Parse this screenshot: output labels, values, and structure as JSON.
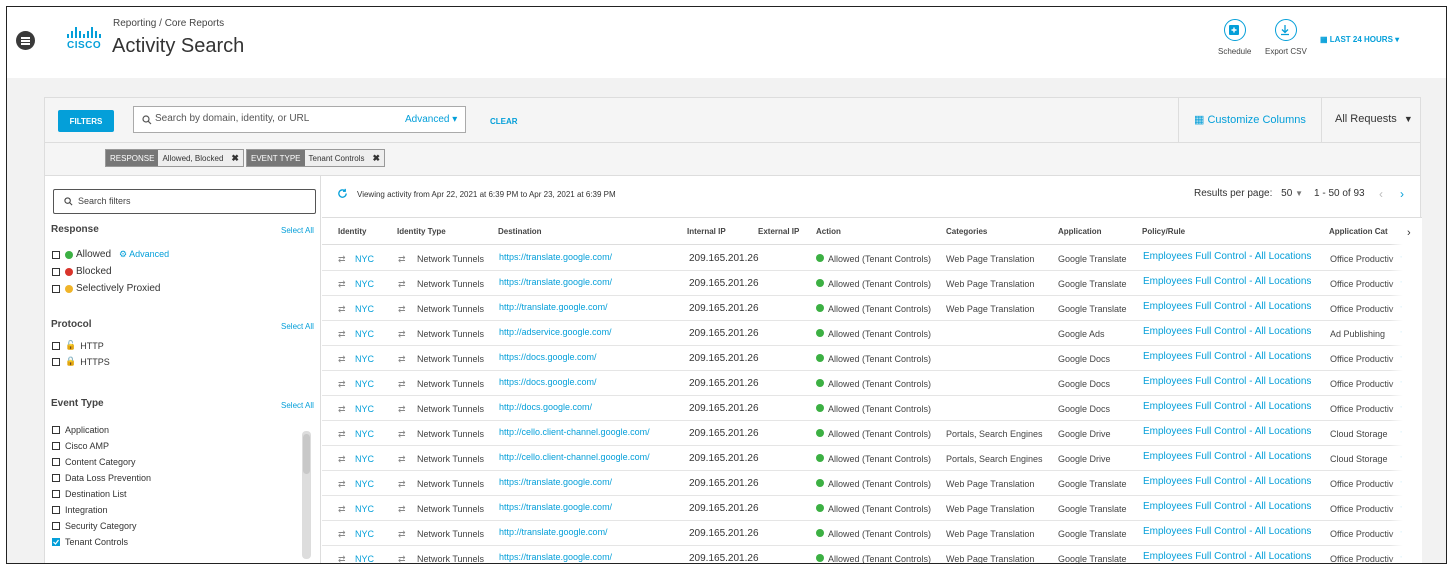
{
  "header": {
    "breadcrumb": "Reporting / Core Reports",
    "title": "Activity Search",
    "logo_text": "CISCO",
    "schedule_label": "Schedule",
    "export_label": "Export CSV",
    "time_range": "LAST 24 HOURS"
  },
  "toolbar": {
    "filters_label": "FILTERS",
    "search_placeholder": "Search by domain, identity, or URL",
    "advanced_label": "Advanced",
    "clear_label": "CLEAR",
    "customize_label": "Customize Columns",
    "requests_label": "All Requests"
  },
  "active_filters": [
    {
      "key": "RESPONSE",
      "value": "Allowed, Blocked"
    },
    {
      "key": "EVENT TYPE",
      "value": "Tenant Controls"
    }
  ],
  "sidebar": {
    "search_placeholder": "Search filters",
    "select_all_label": "Select All",
    "response": {
      "title": "Response",
      "advanced_label": "Advanced",
      "options": [
        "Allowed",
        "Blocked",
        "Selectively Proxied"
      ]
    },
    "protocol": {
      "title": "Protocol",
      "options": [
        "HTTP",
        "HTTPS"
      ]
    },
    "event_type": {
      "title": "Event Type",
      "options": [
        "Application",
        "Cisco AMP",
        "Content Category",
        "Data Loss Prevention",
        "Destination List",
        "Integration",
        "Security Category",
        "Tenant Controls"
      ],
      "checked": "Tenant Controls"
    }
  },
  "results": {
    "viewing_text": "Viewing activity from Apr 22, 2021 at 6:39 PM to Apr 23, 2021 at 6:39 PM",
    "per_page_label": "Results per page:",
    "per_page_value": "50",
    "range_text": "1 - 50 of 93"
  },
  "columns": [
    "Identity",
    "Identity Type",
    "Destination",
    "Internal IP",
    "External IP",
    "Action",
    "Categories",
    "Application",
    "Policy/Rule",
    "Application Cat"
  ],
  "rows": [
    {
      "identity": "NYC",
      "type": "Network Tunnels",
      "destination": "https://translate.google.com/",
      "internal_ip": "209.165.201.26",
      "action": "Allowed (Tenant Controls)",
      "categories": "Web Page Translation",
      "application": "Google Translate",
      "policy": "Employees Full Control - All Locations",
      "app_cat": "Office Productiv"
    },
    {
      "identity": "NYC",
      "type": "Network Tunnels",
      "destination": "https://translate.google.com/",
      "internal_ip": "209.165.201.26",
      "action": "Allowed (Tenant Controls)",
      "categories": "Web Page Translation",
      "application": "Google Translate",
      "policy": "Employees Full Control - All Locations",
      "app_cat": "Office Productiv"
    },
    {
      "identity": "NYC",
      "type": "Network Tunnels",
      "destination": "http://translate.google.com/",
      "internal_ip": "209.165.201.26",
      "action": "Allowed (Tenant Controls)",
      "categories": "Web Page Translation",
      "application": "Google Translate",
      "policy": "Employees Full Control - All Locations",
      "app_cat": "Office Productiv"
    },
    {
      "identity": "NYC",
      "type": "Network Tunnels",
      "destination": "http://adservice.google.com/",
      "internal_ip": "209.165.201.26",
      "action": "Allowed (Tenant Controls)",
      "categories": "",
      "application": "Google Ads",
      "policy": "Employees Full Control - All Locations",
      "app_cat": "Ad Publishing"
    },
    {
      "identity": "NYC",
      "type": "Network Tunnels",
      "destination": "https://docs.google.com/",
      "internal_ip": "209.165.201.26",
      "action": "Allowed (Tenant Controls)",
      "categories": "",
      "application": "Google Docs",
      "policy": "Employees Full Control - All Locations",
      "app_cat": "Office Productiv"
    },
    {
      "identity": "NYC",
      "type": "Network Tunnels",
      "destination": "https://docs.google.com/",
      "internal_ip": "209.165.201.26",
      "action": "Allowed (Tenant Controls)",
      "categories": "",
      "application": "Google Docs",
      "policy": "Employees Full Control - All Locations",
      "app_cat": "Office Productiv"
    },
    {
      "identity": "NYC",
      "type": "Network Tunnels",
      "destination": "http://docs.google.com/",
      "internal_ip": "209.165.201.26",
      "action": "Allowed (Tenant Controls)",
      "categories": "",
      "application": "Google Docs",
      "policy": "Employees Full Control - All Locations",
      "app_cat": "Office Productiv"
    },
    {
      "identity": "NYC",
      "type": "Network Tunnels",
      "destination": "http://cello.client-channel.google.com/",
      "internal_ip": "209.165.201.26",
      "action": "Allowed (Tenant Controls)",
      "categories": "Portals, Search Engines",
      "application": "Google Drive",
      "policy": "Employees Full Control - All Locations",
      "app_cat": "Cloud Storage"
    },
    {
      "identity": "NYC",
      "type": "Network Tunnels",
      "destination": "http://cello.client-channel.google.com/",
      "internal_ip": "209.165.201.26",
      "action": "Allowed (Tenant Controls)",
      "categories": "Portals, Search Engines",
      "application": "Google Drive",
      "policy": "Employees Full Control - All Locations",
      "app_cat": "Cloud Storage"
    },
    {
      "identity": "NYC",
      "type": "Network Tunnels",
      "destination": "https://translate.google.com/",
      "internal_ip": "209.165.201.26",
      "action": "Allowed (Tenant Controls)",
      "categories": "Web Page Translation",
      "application": "Google Translate",
      "policy": "Employees Full Control - All Locations",
      "app_cat": "Office Productiv"
    },
    {
      "identity": "NYC",
      "type": "Network Tunnels",
      "destination": "https://translate.google.com/",
      "internal_ip": "209.165.201.26",
      "action": "Allowed (Tenant Controls)",
      "categories": "Web Page Translation",
      "application": "Google Translate",
      "policy": "Employees Full Control - All Locations",
      "app_cat": "Office Productiv"
    },
    {
      "identity": "NYC",
      "type": "Network Tunnels",
      "destination": "http://translate.google.com/",
      "internal_ip": "209.165.201.26",
      "action": "Allowed (Tenant Controls)",
      "categories": "Web Page Translation",
      "application": "Google Translate",
      "policy": "Employees Full Control - All Locations",
      "app_cat": "Office Productiv"
    },
    {
      "identity": "NYC",
      "type": "Network Tunnels",
      "destination": "https://translate.google.com/",
      "internal_ip": "209.165.201.26",
      "action": "Allowed (Tenant Controls)",
      "categories": "Web Page Translation",
      "application": "Google Translate",
      "policy": "Employees Full Control - All Locations",
      "app_cat": "Office Productiv"
    }
  ],
  "colors": {
    "accent": "#049fd9",
    "allowed": "#3cb043",
    "blocked": "#d9342b",
    "proxied": "#f0b429"
  }
}
